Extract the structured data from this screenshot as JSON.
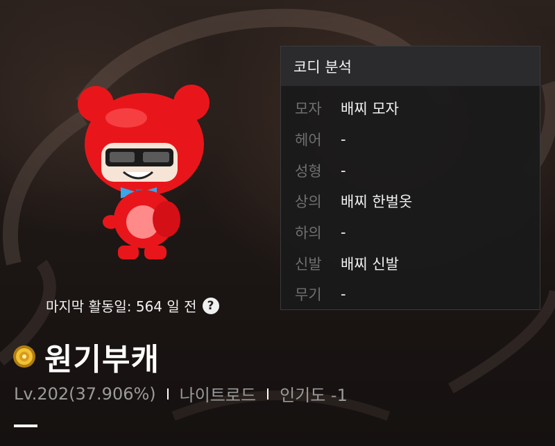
{
  "profile": {
    "last_active": "마지막 활동일: 564 일 전",
    "help_glyph": "?",
    "name": "원기부캐",
    "level": "Lv.202(37.906%)",
    "job": "나이트로드",
    "popularity": "인기도 -1"
  },
  "coordi_panel": {
    "title": "코디 분석",
    "rows": [
      {
        "label": "모자",
        "value": "배찌 모자"
      },
      {
        "label": "헤어",
        "value": "-"
      },
      {
        "label": "성형",
        "value": "-"
      },
      {
        "label": "상의",
        "value": "배찌 한벌옷"
      },
      {
        "label": "하의",
        "value": "-"
      },
      {
        "label": "신발",
        "value": "배찌 신발"
      },
      {
        "label": "무기",
        "value": "-"
      }
    ]
  },
  "colors": {
    "accent": "#ffffff",
    "muted_text": "#9b9b9b",
    "panel_bg": "#1a1a1b",
    "panel_header_bg": "#2b2b2d",
    "costume_red": "#e8161b"
  },
  "icons": {
    "help": "question-circle-icon",
    "server": "gold-coin-icon"
  }
}
